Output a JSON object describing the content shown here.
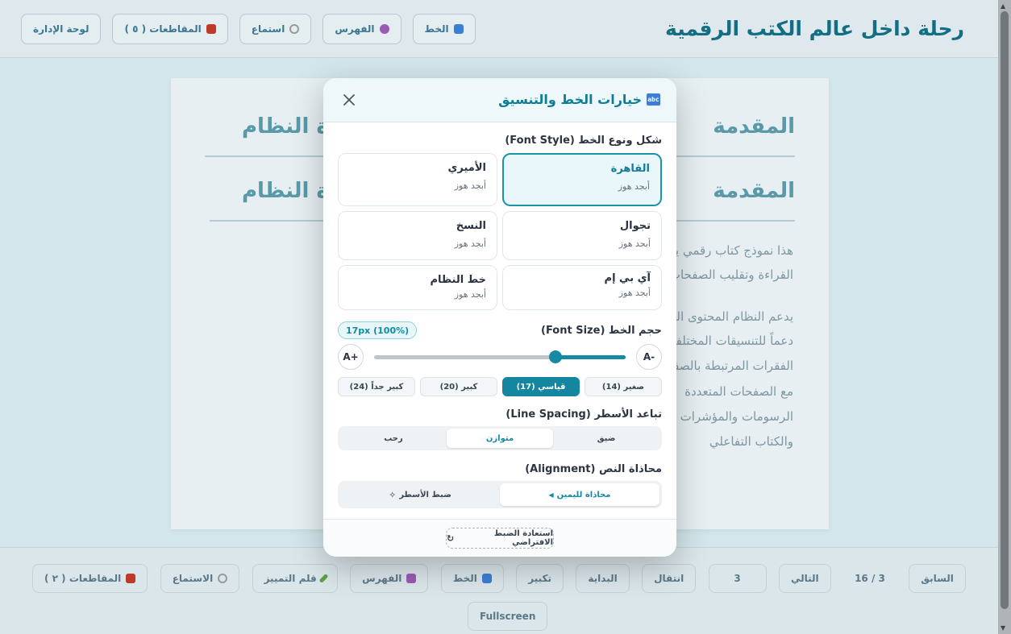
{
  "topbar": {
    "title": "رحلة داخل عالم الكتب الرقمية",
    "buttons": [
      {
        "label": "لوحة الإدارة",
        "icon": "none",
        "color": ""
      },
      {
        "label": "المقاطعات ( ٥ )",
        "icon": "bookmark-icon",
        "color": "#c0392b"
      },
      {
        "label": "استماع",
        "icon": "headphones-icon",
        "color": "#999999"
      },
      {
        "label": "الفهرس",
        "icon": "toc-icon",
        "color": "#9b59b6"
      },
      {
        "label": "الخط",
        "icon": "font-icon",
        "color": "#3a7fd5"
      }
    ]
  },
  "book": {
    "heading1_right": "المقدمة",
    "heading1_left": "عن فكرة النظام",
    "heading2_right": "المقدمة",
    "heading2_left": "عن فكرة النظام",
    "lines": [
      "هذا نموذج كتاب رقمي يعرض فكرة النظام وكيف يعمل مع إتاحة",
      "القراءة وتقليب الصفحات في إطار يحاكي تجربة الكتب الواقع وتفاصيلها",
      "يدعم النظام المحتوى العربي بخطوط واضحة ومريحة",
      "دعماً للتنسيقات المختلفة وإعدادات القراءة الحديثة",
      "الفقرات المرتبطة بالصفحات والعناوين",
      "مع الصفحات المتعددة",
      "الرسومات والمؤشرات والإضافات",
      "والكتاب التفاعلي"
    ]
  },
  "bottombar": {
    "buttons": [
      {
        "label": "المقاطعات ( ٢ )",
        "icon": "bookmark-icon",
        "color": "#c0392b"
      },
      {
        "label": "الاستماع",
        "icon": "headphones-icon",
        "color": "#999999"
      },
      {
        "label": "قلم التمييز",
        "icon": "pen-icon",
        "color": "#5ba34a"
      },
      {
        "label": "الفهرس",
        "icon": "toc-icon",
        "color": "#9b59b6"
      },
      {
        "label": "الخط",
        "icon": "font-icon",
        "color": "#3a7fd5"
      },
      {
        "label": "تكبير",
        "icon": "none",
        "color": ""
      },
      {
        "label": "البداية",
        "icon": "none",
        "color": ""
      },
      {
        "label": "انتقال",
        "icon": "none",
        "color": ""
      },
      {
        "label": "3",
        "icon": "none",
        "color": ""
      },
      {
        "label": "التالي",
        "icon": "none",
        "color": ""
      },
      {
        "label": "16 / 3",
        "icon": "none",
        "color": ""
      },
      {
        "label": "السابق",
        "icon": "none",
        "color": ""
      }
    ],
    "fullscreen": "Fullscreen"
  },
  "modal": {
    "icon_text": "abc",
    "title": "خيارات الخط والتنسيق",
    "font_style_label": "شكل ونوع الخط (Font Style)",
    "fonts": [
      {
        "name": "القاهرة",
        "sample": "أبجد هوز",
        "selected": true
      },
      {
        "name": "الأميري",
        "sample": "أبجد هوز",
        "selected": false
      },
      {
        "name": "تجوال",
        "sample": "أبجد هوز",
        "selected": false
      },
      {
        "name": "النسخ",
        "sample": "أبجد هوز",
        "selected": false
      },
      {
        "name": "آي بي إم",
        "sample": "أبجد هوز",
        "selected": false
      },
      {
        "name": "خط النظام",
        "sample": "أبجد هوز",
        "selected": false
      }
    ],
    "font_size_label": "حجم الخط (Font Size)",
    "size_badge": "17px (100%)",
    "decrease_label": "A-",
    "increase_label": "A+",
    "slider_fraction": 0.72,
    "size_presets": [
      {
        "label": "صغير (14)",
        "active": false
      },
      {
        "label": "قياسي (17)",
        "active": true
      },
      {
        "label": "كبير (20)",
        "active": false
      },
      {
        "label": "كبير جداً (24)",
        "active": false
      }
    ],
    "line_spacing_label": "تباعد الأسطر (Line Spacing)",
    "spacing_options": [
      {
        "label": "ضيق",
        "active": false
      },
      {
        "label": "متوازن",
        "active": true
      },
      {
        "label": "رحب",
        "active": false
      }
    ],
    "alignment_label": "محاذاة النص (Alignment)",
    "alignment_options": [
      {
        "label": "محاذاة لليمين",
        "active": true
      },
      {
        "label": "ضبط الأسطر",
        "active": false
      }
    ],
    "reset_label": "استعادة الضبط الافتراضي",
    "accent_color": "#15869f"
  }
}
